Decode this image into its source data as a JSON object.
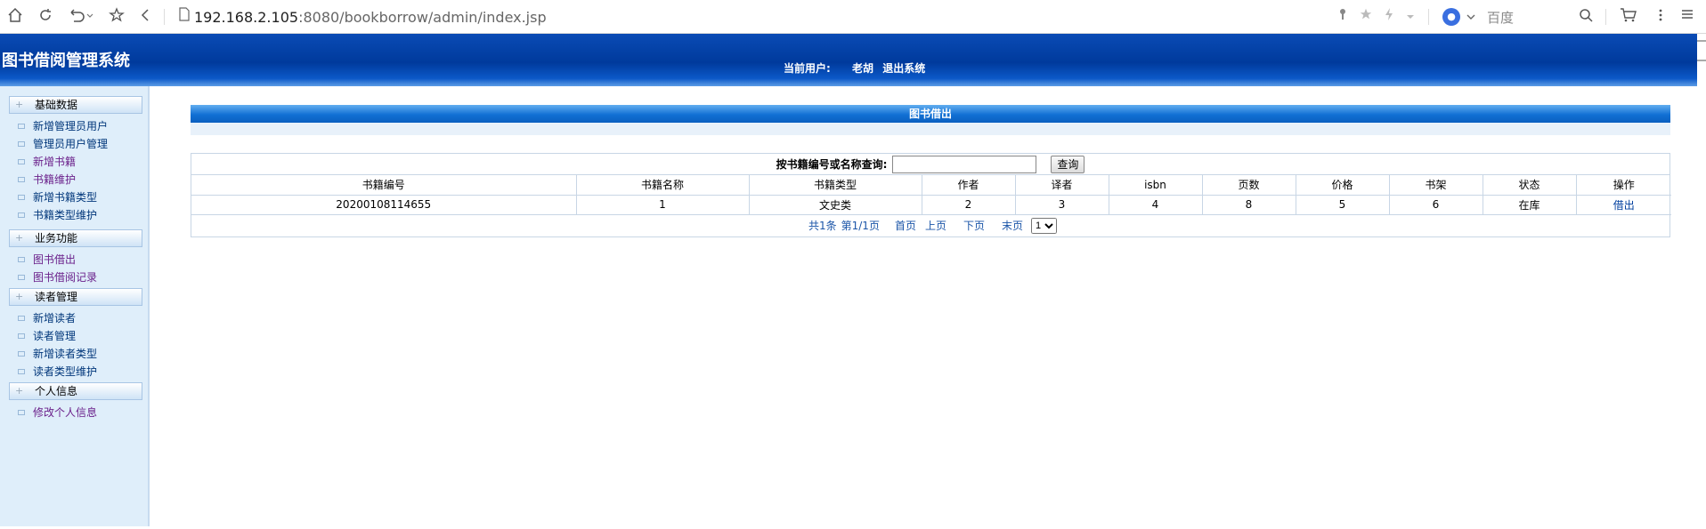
{
  "browser": {
    "url_host": "192.168.2.105",
    "url_rest": ":8080/bookborrow/admin/index.jsp",
    "search_engine": "百度",
    "icons": [
      "home-icon",
      "refresh-icon",
      "undo-icon",
      "star-icon",
      "back-icon",
      "key-icon",
      "star-icon",
      "lightning-icon",
      "chevron-down-icon",
      "paw-icon",
      "search-icon",
      "cart-icon",
      "more-icon",
      "menu-icon"
    ]
  },
  "header": {
    "title": "图书借阅管理系统",
    "current_user_label": "当前用户:",
    "user_name": "老胡",
    "logout": "退出系统"
  },
  "sidebar": {
    "groups": [
      {
        "label": "基础数据",
        "items": [
          "新增管理员用户",
          "管理员用户管理",
          "新增书籍",
          "书籍维护",
          "新增书籍类型",
          "书籍类型维护"
        ]
      },
      {
        "label": "业务功能",
        "items": [
          "图书借出",
          "图书借阅记录"
        ]
      },
      {
        "label": "读者管理",
        "items": [
          "新增读者",
          "读者管理",
          "新增读者类型",
          "读者类型维护"
        ]
      },
      {
        "label": "个人信息",
        "items": [
          "修改个人信息"
        ]
      }
    ]
  },
  "main": {
    "panel_title": "图书借出",
    "search": {
      "label": "按书籍编号或名称查询:",
      "value": "",
      "button": "查询"
    },
    "table": {
      "headers": [
        "书籍编号",
        "书籍名称",
        "书籍类型",
        "作者",
        "译者",
        "isbn",
        "页数",
        "价格",
        "书架",
        "状态",
        "操作"
      ],
      "rows": [
        [
          "20200108114655",
          "1",
          "文史类",
          "2",
          "3",
          "4",
          "8",
          "5",
          "6",
          "在库",
          "借出"
        ]
      ]
    },
    "pager": {
      "total": "共1条",
      "page_info": "第1/1页",
      "first": "首页",
      "prev": "上页",
      "next": "下页",
      "last": "末页",
      "page_select": "1"
    }
  },
  "colors": {
    "header_blue": "#003a9c",
    "panel_blue": "#1170d4",
    "sidebar_bg": "#dfeefa",
    "link": "#003f9e"
  }
}
